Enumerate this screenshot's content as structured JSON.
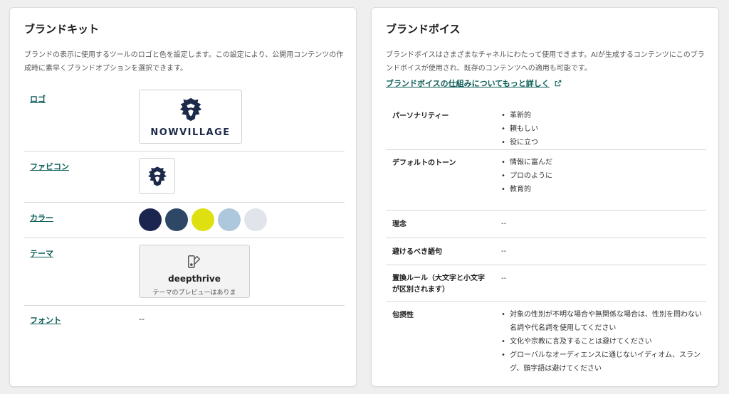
{
  "brand_kit": {
    "title": "ブランドキット",
    "description": "ブランドの表示に使用するツールのロゴと色を設定します。この設定により、公開用コンテンツの作成時に素早くブランドオプションを選択できます。",
    "rows": {
      "logo": {
        "label": "ロゴ",
        "logo_text": "NOWVILLAGE"
      },
      "favicon": {
        "label": "ファビコン"
      },
      "colors": {
        "label": "カラー",
        "swatches": [
          "#1c2450",
          "#2e4766",
          "#dfe010",
          "#adc7dd",
          "#e2e4ec"
        ]
      },
      "theme": {
        "label": "テーマ",
        "name": "deepthrive",
        "note": "テーマのプレビューはありま"
      },
      "font": {
        "label": "フォント",
        "value": "--"
      }
    }
  },
  "brand_voice": {
    "title": "ブランドボイス",
    "description": "ブランドボイスはさまざまなチャネルにわたって使用できます。AIが生成するコンテンツにこのブランドボイスが使用され、既存のコンテンツへの適用も可能です。",
    "learn_more_link": "ブランドボイスの仕組みについてもっと詳しく",
    "rows": {
      "personality": {
        "label": "パーソナリティー",
        "items": [
          "革新的",
          "頼もしい",
          "役に立つ"
        ]
      },
      "default_tone": {
        "label": "デフォルトのトーン",
        "items": [
          "情報に富んだ",
          "プロのように",
          "教育的"
        ]
      },
      "philosophy": {
        "label": "理念",
        "value": "--"
      },
      "avoid_phrases": {
        "label": "避けるべき語句",
        "value": "--"
      },
      "replacement_rules": {
        "label": "置換ルール（大文字と小文字が区別されます）",
        "value": "--"
      },
      "inclusivity": {
        "label": "包摂性",
        "items": [
          "対象の性別が不明な場合や無関係な場合は、性別を問わない名詞や代名詞を使用してください",
          "文化や宗教に言及することは避けてください",
          "グローバルなオーディエンスに通じないイディオム、スラング、頭字語は避けてください"
        ]
      }
    }
  }
}
